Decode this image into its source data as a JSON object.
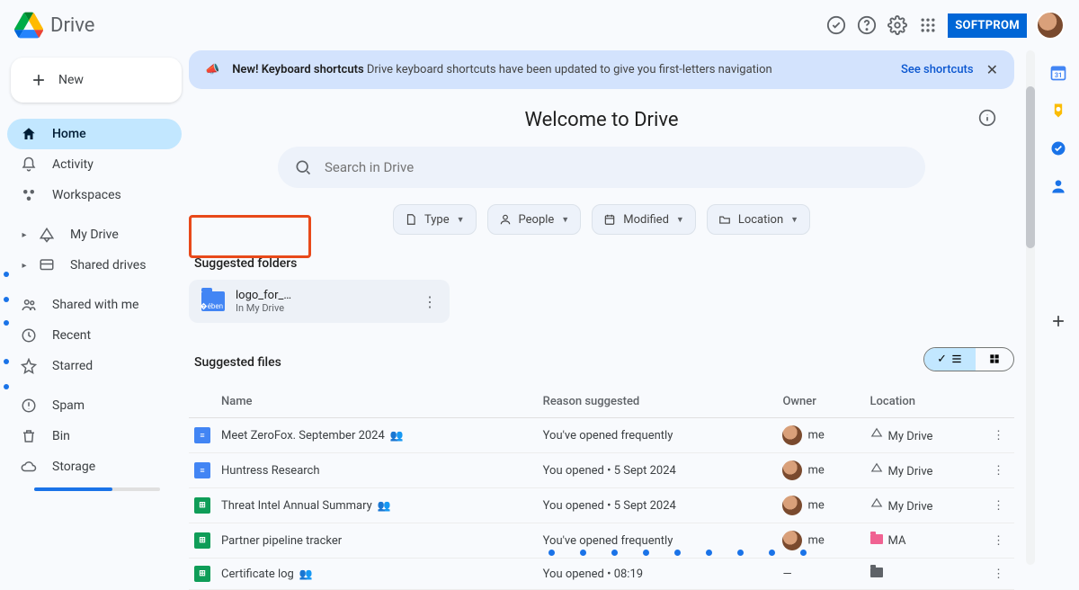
{
  "header": {
    "product": "Drive",
    "partner_badge": "SOFTPROM"
  },
  "sidebar": {
    "new_label": "New",
    "items": [
      {
        "label": "Home",
        "active": true
      },
      {
        "label": "Activity"
      },
      {
        "label": "Workspaces"
      },
      {
        "label": "My Drive",
        "expandable": true
      },
      {
        "label": "Shared drives",
        "expandable": true
      },
      {
        "label": "Shared with me"
      },
      {
        "label": "Recent"
      },
      {
        "label": "Starred"
      },
      {
        "label": "Spam"
      },
      {
        "label": "Bin"
      },
      {
        "label": "Storage"
      }
    ]
  },
  "banner": {
    "bold": "New! Keyboard shortcuts",
    "text": "Drive keyboard shortcuts have been updated to give you first-letters navigation",
    "link": "See shortcuts"
  },
  "main": {
    "welcome": "Welcome to Drive",
    "search_placeholder": "Search in Drive",
    "chips": [
      "Type",
      "People",
      "Modified",
      "Location"
    ],
    "suggested_folders_label": "Suggested folders",
    "suggested_folder": {
      "name": "logo_for_…",
      "loc": "In My Drive"
    },
    "suggested_files_label": "Suggested files",
    "columns": {
      "name": "Name",
      "reason": "Reason suggested",
      "owner": "Owner",
      "location": "Location"
    },
    "rows": [
      {
        "icon": "doc",
        "name": "Meet ZeroFox. September 2024",
        "shared": true,
        "reason": "You've opened frequently",
        "owner": "me",
        "location": "My Drive",
        "loctype": "drive"
      },
      {
        "icon": "doc",
        "name": "Huntress Research",
        "shared": false,
        "reason": "You opened • 5 Sept 2024",
        "owner": "me",
        "location": "My Drive",
        "loctype": "drive"
      },
      {
        "icon": "sheet",
        "name": "Threat Intel Annual Summary",
        "shared": true,
        "reason": "You opened • 5 Sept 2024",
        "owner": "me",
        "location": "My Drive",
        "loctype": "drive"
      },
      {
        "icon": "sheet",
        "name": "Partner pipeline tracker",
        "shared": false,
        "reason": "You've opened frequently",
        "owner": "me",
        "location": "MA",
        "loctype": "pink"
      },
      {
        "icon": "sheet",
        "name": "Certificate log",
        "shared": true,
        "reason": "You opened • 08:19",
        "owner": "—",
        "location": "",
        "loctype": "shared"
      }
    ]
  }
}
